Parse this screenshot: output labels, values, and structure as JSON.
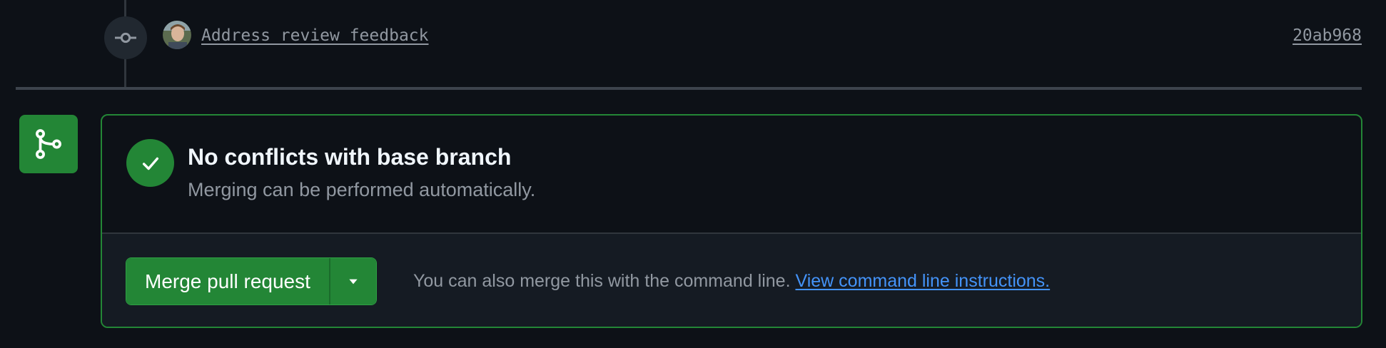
{
  "commit": {
    "message": "Address review feedback",
    "sha": "20ab968",
    "icon": "git-commit-icon",
    "avatar": "user-avatar"
  },
  "merge": {
    "icon": "git-merge-icon",
    "status_icon": "check-icon",
    "status_title": "No conflicts with base branch",
    "status_subtitle": "Merging can be performed automatically.",
    "merge_button_label": "Merge pull request",
    "dropdown_icon": "triangle-down-icon",
    "hint_text": "You can also merge this with the command line.",
    "hint_link": "View command line instructions."
  },
  "colors": {
    "background": "#0d1117",
    "success": "#238636",
    "link": "#4493f8",
    "muted_text": "#9198a1",
    "title_text": "#f0f6fc"
  }
}
